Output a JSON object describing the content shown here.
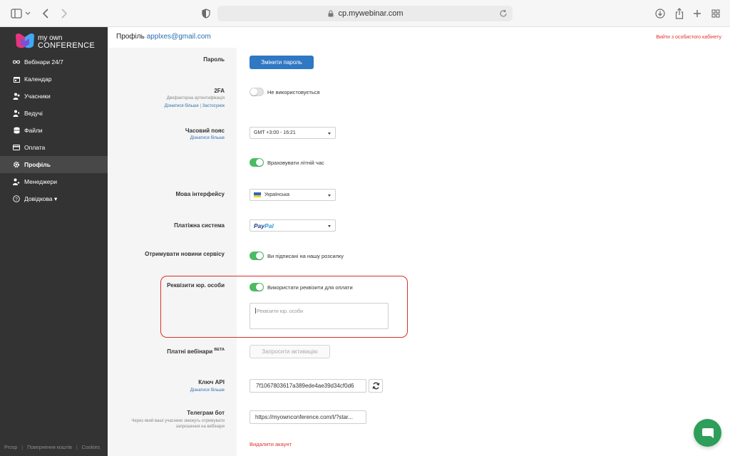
{
  "browser": {
    "url": "cp.mywebinar.com"
  },
  "logo": {
    "line1": "my own",
    "line2": "CONFERENCE"
  },
  "sidebar": {
    "items": [
      {
        "label": "Вебінари 24/7",
        "icon": "infinity-icon"
      },
      {
        "label": "Календар",
        "icon": "calendar-icon"
      },
      {
        "label": "Учасники",
        "icon": "participants-icon"
      },
      {
        "label": "Ведучі",
        "icon": "presenter-icon"
      },
      {
        "label": "Файли",
        "icon": "files-icon"
      },
      {
        "label": "Оплата",
        "icon": "card-icon"
      },
      {
        "label": "Профіль",
        "icon": "gear-icon",
        "active": true
      },
      {
        "label": "Менеджери",
        "icon": "managers-icon"
      },
      {
        "label": "Довідкова ▾",
        "icon": "help-icon"
      }
    ],
    "footer": [
      "Prosp",
      "Повернення коштів",
      "Cookies"
    ]
  },
  "header": {
    "title": "Профіль",
    "email": "applxes@gmail.com",
    "logout": "Вийти з особистого кабінету"
  },
  "form": {
    "password": {
      "label": "Пароль",
      "button": "Змінити пароль"
    },
    "twofa": {
      "label": "2FA",
      "sub": "Двофакторна аутентифікація",
      "link1": "Дізнатися більше",
      "sep": "|",
      "link2": "Застосунок",
      "toggle_label": "Не використовується",
      "enabled": false
    },
    "timezone": {
      "label": "Часовий пояс",
      "link": "Дізнатися більше",
      "value": "GMT +3:00 - 16:21",
      "dst_label": "Враховувати літній час",
      "dst_enabled": true
    },
    "language": {
      "label": "Мова інтерфейсу",
      "value": "Українська"
    },
    "payment": {
      "label": "Платіжна система",
      "value_part1": "Pay",
      "value_part2": "Pal"
    },
    "news": {
      "label": "Отримувати новини сервісу",
      "toggle_label": "Ви підписані на нашу розсилку",
      "enabled": true
    },
    "requisites": {
      "label": "Реквізити юр. особи",
      "toggle_label": "Використати реквізити для оплати",
      "enabled": true,
      "placeholder": "Реквізити юр. особи"
    },
    "paid": {
      "label": "Платні вебінари",
      "beta": "BETA",
      "button": "Запросити активацію"
    },
    "api": {
      "label": "Ключ API",
      "link": "Дізнатися більше",
      "value": "7f1067803617a389ede4ae39d34cf0d6"
    },
    "telegram": {
      "label": "Телеграм бот",
      "sub": "Через який ваші учасники зможуть отримувати запрошення на вебінари",
      "value": "https://myownconference.com/t/?star..."
    },
    "delete": "Видалити акаунт"
  },
  "colors": {
    "accent": "#2f78c4",
    "toggle_on": "#4cbb61",
    "danger": "#e0322d",
    "sidebar": "#333333",
    "chat": "#2e9e5b"
  }
}
